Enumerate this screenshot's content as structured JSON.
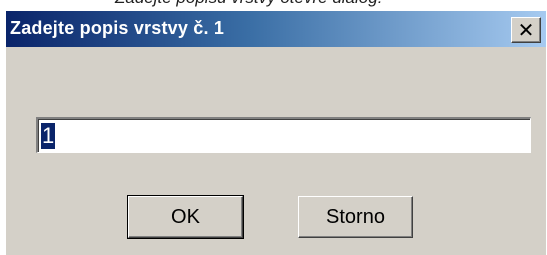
{
  "caption": {
    "text": "Zadejte popisu vrstvy otevře dialog:"
  },
  "dialog": {
    "title": "Zadejte popis vrstvy  č. 1",
    "close_icon": "close-icon",
    "close_glyph": "✕",
    "input_value": "1",
    "ok_label": "OK",
    "cancel_label": "Storno"
  },
  "colors": {
    "titlebar_start": "#0a246a",
    "titlebar_end": "#a6caf0",
    "dialog_face": "#d4d0c8",
    "selection": "#0a246a"
  }
}
